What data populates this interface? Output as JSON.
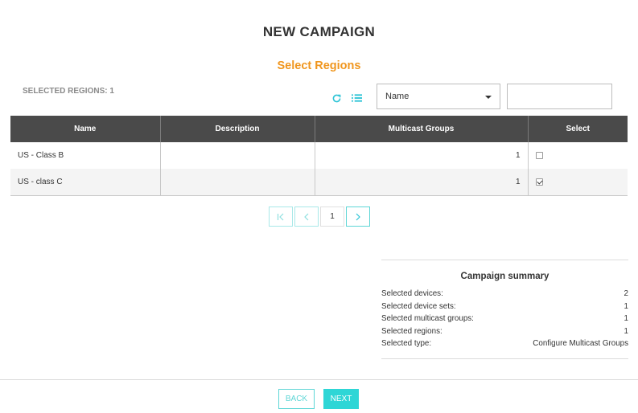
{
  "page": {
    "title": "NEW CAMPAIGN",
    "section_title": "Select Regions"
  },
  "toolbar": {
    "selected_label": "SELECTED REGIONS: 1",
    "refresh_icon": "refresh-icon",
    "list_icon": "list-icon",
    "filter": {
      "selected": "Name"
    },
    "search": {
      "value": "",
      "placeholder": ""
    }
  },
  "table": {
    "columns": [
      "Name",
      "Description",
      "Multicast Groups",
      "Select"
    ],
    "rows": [
      {
        "name": "US - Class B",
        "description": "",
        "multicast_groups": "1",
        "selected": false
      },
      {
        "name": "US - class C",
        "description": "",
        "multicast_groups": "1",
        "selected": true
      }
    ]
  },
  "pagination": {
    "current_page": "1"
  },
  "summary": {
    "title": "Campaign summary",
    "rows": [
      {
        "label": "Selected devices:",
        "value": "2"
      },
      {
        "label": "Selected device sets:",
        "value": "1"
      },
      {
        "label": "Selected multicast groups:",
        "value": "1"
      },
      {
        "label": "Selected regions:",
        "value": "1"
      },
      {
        "label": "Selected type:",
        "value": "Configure Multicast Groups"
      }
    ]
  },
  "footer": {
    "back_label": "BACK",
    "next_label": "NEXT"
  },
  "colors": {
    "accent": "#2ed6d6",
    "section_title": "#f0961e",
    "table_header": "#4a4a4a"
  }
}
